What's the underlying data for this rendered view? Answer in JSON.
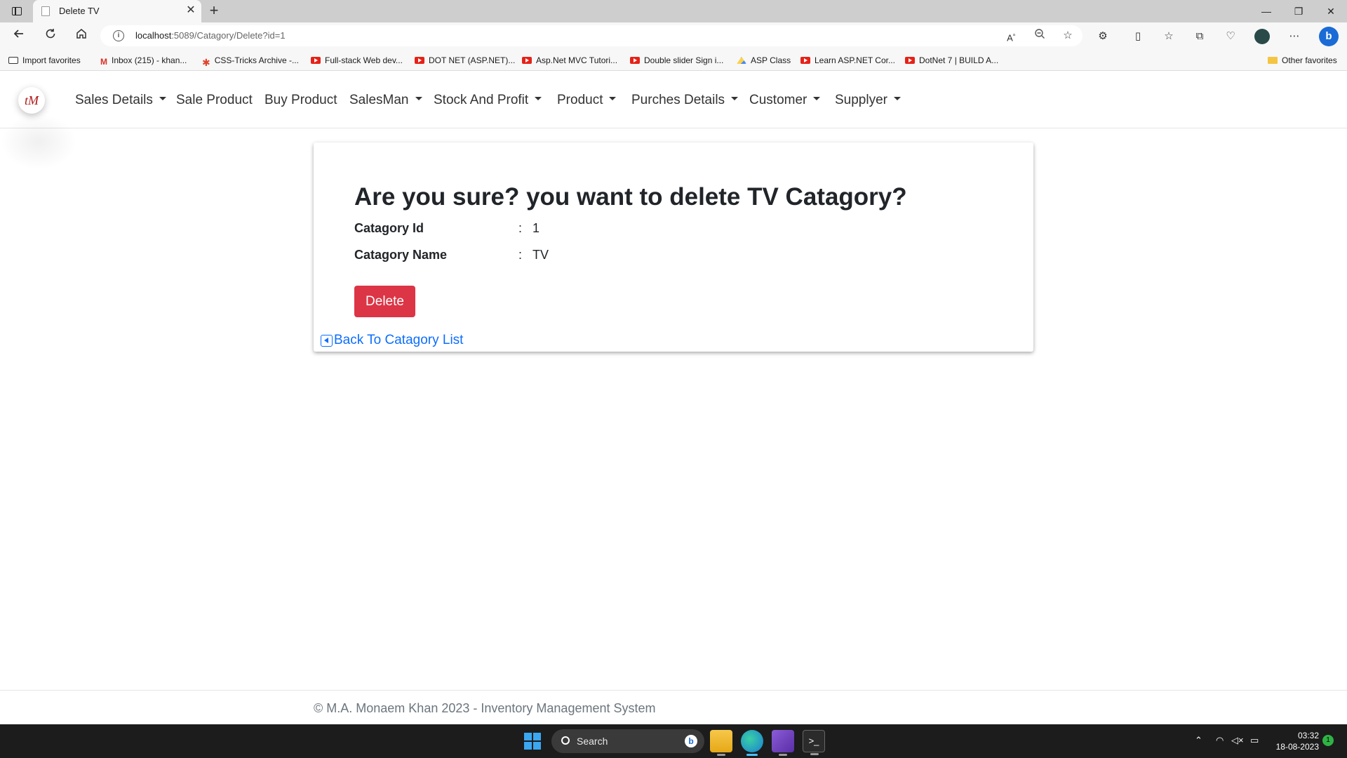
{
  "browser": {
    "tab_title": "Delete TV",
    "close_tab": "✕",
    "new_tab": "+",
    "window_controls": {
      "minimize": "—",
      "restore": "❐",
      "close": "✕"
    },
    "url_host": "localhost",
    "url_rest": ":5089/Catagory/Delete?id=1",
    "favorites": [
      {
        "label": "Import favorites",
        "icon": "import-icon"
      },
      {
        "label": "Inbox (215) - khan...",
        "icon": "gmail-icon"
      },
      {
        "label": "CSS-Tricks Archive -...",
        "icon": "css-tricks-icon"
      },
      {
        "label": "Full-stack Web dev...",
        "icon": "youtube-icon"
      },
      {
        "label": "DOT NET (ASP.NET)...",
        "icon": "youtube-icon"
      },
      {
        "label": "Asp.Net MVC Tutori...",
        "icon": "youtube-icon"
      },
      {
        "label": "Double slider Sign i...",
        "icon": "youtube-icon"
      },
      {
        "label": "ASP Class",
        "icon": "google-drive-icon"
      },
      {
        "label": "Learn ASP.NET Cor...",
        "icon": "youtube-icon"
      },
      {
        "label": "DotNet 7 | BUILD A...",
        "icon": "youtube-icon"
      }
    ],
    "other_favorites": "Other favorites"
  },
  "site": {
    "logo_text": "tM",
    "nav": [
      {
        "label": "Sales Details",
        "dropdown": true
      },
      {
        "label": "Sale Product",
        "dropdown": false
      },
      {
        "label": "Buy Product",
        "dropdown": false
      },
      {
        "label": "SalesMan",
        "dropdown": true
      },
      {
        "label": "Stock And Profit",
        "dropdown": true
      },
      {
        "label": "Product",
        "dropdown": true
      },
      {
        "label": "Purches Details",
        "dropdown": true
      },
      {
        "label": "Customer",
        "dropdown": true
      },
      {
        "label": "Supplyer",
        "dropdown": true
      }
    ]
  },
  "card": {
    "title": "Are you sure? you want to delete TV Catagory?",
    "fields": [
      {
        "label": "Catagory Id",
        "sep": ":",
        "value": "1"
      },
      {
        "label": "Catagory Name",
        "sep": ":",
        "value": "TV"
      }
    ],
    "delete_label": "Delete",
    "back_label": "Back To Catagory List"
  },
  "footer": {
    "text": "© M.A. Monaem Khan 2023 - Inventory Management System"
  },
  "taskbar": {
    "search_label": "Search",
    "time": "03:32",
    "date": "18-08-2023",
    "notification_count": "1"
  },
  "colors": {
    "danger": "#dc3545",
    "link": "#0d6efd",
    "footer_text": "#6c757d",
    "taskbar": "#1c1c1c"
  }
}
